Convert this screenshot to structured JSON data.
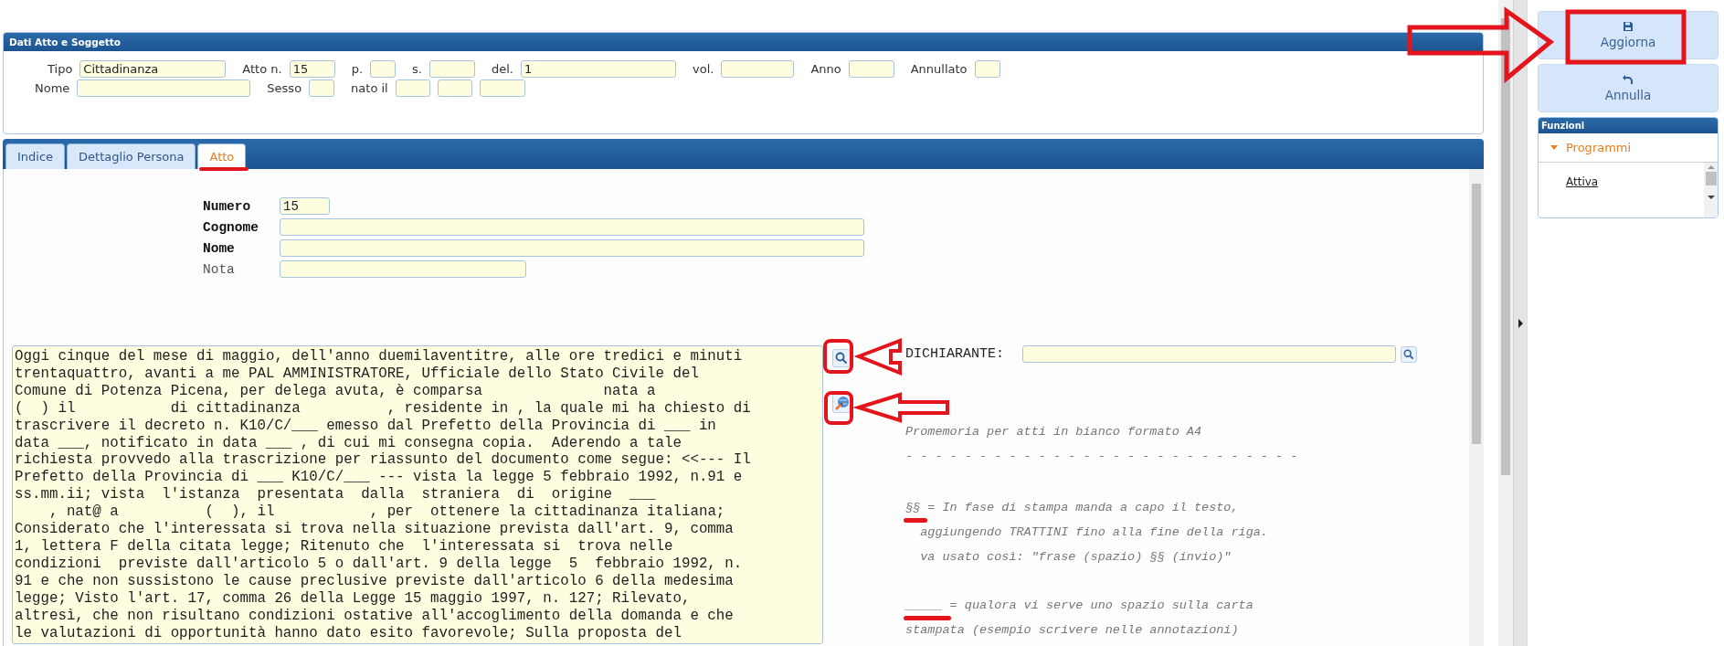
{
  "soggetto": {
    "title": "Dati Atto e Soggetto",
    "rows": [
      [
        {
          "label": "Tipo",
          "value": "Cittadinanza"
        },
        {
          "label": "Atto n.",
          "value": "15"
        },
        {
          "label": "p."
        },
        {
          "label": "s."
        },
        {
          "label": "del.",
          "value": "1"
        },
        {
          "label": "vol."
        },
        {
          "label": "Anno"
        },
        {
          "label": "Annullato"
        }
      ],
      [
        {
          "label": "Nome"
        },
        {
          "label": "Sesso"
        },
        {
          "label": "nato il"
        },
        {},
        {}
      ]
    ]
  },
  "tabs": [
    {
      "label": "Indice",
      "selected": false
    },
    {
      "label": "Dettaglio Persona",
      "selected": false
    },
    {
      "label": "Atto",
      "selected": true
    }
  ],
  "atto_fields": [
    {
      "label": "Numero",
      "value": "15",
      "bold": true
    },
    {
      "label": "Cognome",
      "bold": true
    },
    {
      "label": "Nome",
      "bold": true
    },
    {
      "label": "Nota",
      "bold": false
    }
  ],
  "testo": "Oggi cinque del mese di maggio, dell'anno duemilaventitre, alle ore tredici e minuti\ntrentaquattro, avanti a me PAL AMMINISTRATORE, Ufficiale dello Stato Civile del\nComune di Potenza Picena, per delega avuta, è comparsa              nata a\n(  ) il           di cittadinanza          , residente in , la quale mi ha chiesto di\ntrascrivere il decreto n. K10/C/___ emesso dal Prefetto della Provincia di ___ in\ndata ___, notificato in data ___ , di cui mi consegna copia.  Aderendo a tale\nrichiesta provvedo alla trascrizione per riassunto del documento come segue: <<--- Il\nPrefetto della Provincia di ___ K10/C/___ --- vista la legge 5 febbraio 1992, n.91 e\nss.mm.ii; vista  l'istanza  presentata  dalla  straniera  di  origine  ___\n    , nat@ a          (  ), il           , per  ottenere la cittadinanza italiana;\nConsiderato che l'interessata si trova nella situazione prevista dall'art. 9, comma\n1, lettera F della citata legge; Ritenuto che  l'interessata si  trova nelle\ncondizioni  previste dall'articolo 5 o dall'art. 9 della legge  5  febbraio 1992, n.\n91 e che non sussistono le cause preclusive previste dall'articolo 6 della medesima\nlegge; Visto l'art. 17, comma 26 della Legge 15 maggio 1997, n. 127; Rilevato,\naltresì, che non risultano condizioni ostative all'accoglimento della domanda e che\nle valutazioni di opportunità hanno dato esito favorevole; Sulla proposta del",
  "dichiarante": {
    "label": "DICHIARANTE:"
  },
  "promemoria": [
    [
      "Promemoria per atti in bianco formato A4"
    ],
    [
      "- - - - - - - - - - - - - - - - - - - - - - - - - - -"
    ],
    [
      "§§ = In fase di stampa manda a capo il testo,",
      "  aggiungendo TRATTINI fino alla fine della riga.",
      "  va usato così: \"frase (spazio) §§ (invio)\""
    ],
    [
      "_____ = qualora vi serve uno spazio sulla carta",
      "stampata (esempio scrivere nelle annotazioni)"
    ]
  ],
  "actions": [
    {
      "label": "Aggiorna",
      "kind": "save"
    },
    {
      "label": "Annulla",
      "kind": "undo"
    }
  ],
  "funzioni": {
    "title": "Funzioni",
    "group": "Programmi",
    "expanded": true,
    "items": [
      "Attiva"
    ]
  }
}
